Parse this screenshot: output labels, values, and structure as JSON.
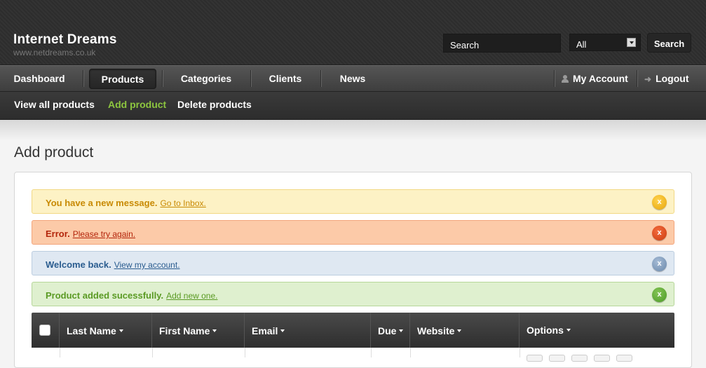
{
  "header": {
    "title": "Internet Dreams",
    "subtitle": "www.netdreams.co.uk",
    "search": {
      "value": "Search",
      "select_value": "All",
      "button_label": "Search"
    }
  },
  "nav": {
    "items": [
      {
        "label": "Dashboard",
        "active": false
      },
      {
        "label": "Products",
        "active": true
      },
      {
        "label": "Categories",
        "active": false
      },
      {
        "label": "Clients",
        "active": false
      },
      {
        "label": "News",
        "active": false
      }
    ],
    "my_account": "My Account",
    "logout": "Logout",
    "icons": {
      "account": "user-icon",
      "logout": "arrow-right-icon"
    }
  },
  "subnav": {
    "items": [
      {
        "label": "View all products",
        "active": false
      },
      {
        "label": "Add product",
        "active": true
      },
      {
        "label": "Delete products",
        "active": false
      }
    ],
    "active_color": "#8dc63f"
  },
  "page": {
    "title": "Add product"
  },
  "alerts": [
    {
      "type": "warning",
      "message": "You have a new message.",
      "link": "Go to Inbox.",
      "close": "x"
    },
    {
      "type": "error",
      "message": "Error.",
      "link": "Please try again.",
      "close": "x"
    },
    {
      "type": "info",
      "message": "Welcome back.",
      "link": "View my account.",
      "close": "x"
    },
    {
      "type": "success",
      "message": "Product added sucessfully.",
      "link": "Add new one.",
      "close": "x"
    }
  ],
  "table": {
    "columns": [
      "Last Name",
      "First Name",
      "Email",
      "Due",
      "Website",
      "Options"
    ]
  }
}
